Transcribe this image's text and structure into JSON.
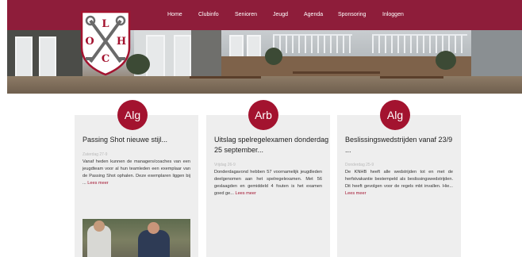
{
  "nav": {
    "items": [
      {
        "label": "Home"
      },
      {
        "label": "Clubinfo"
      },
      {
        "label": "Senioren"
      },
      {
        "label": "Jeugd"
      },
      {
        "label": "Agenda"
      },
      {
        "label": "Sponsoring"
      },
      {
        "label": "Inloggen"
      }
    ]
  },
  "logo": {
    "letters": [
      "L",
      "O",
      "H",
      "C"
    ]
  },
  "posts": [
    {
      "badge": "Alg",
      "title": "Passing Shot nieuwe stijl...",
      "date": "Zaterdag 27-9",
      "excerpt": "Vanaf heden kunnen de managers/coaches van een jeugdteam voor al hun teamleden een exemplaar van de Passing Shot ophalen. Deze exemplaren liggen bij ...",
      "more": "Lees meer"
    },
    {
      "badge": "Arb",
      "title": "Uitslag spelregelexamen donderdag 25 september...",
      "date": "Vrijdag 26-9",
      "excerpt": "Donderdagavond hebben 57 voornamelijk jeugdleden deelgenomen aan het spelregelexamen. Met 56 geslaagden en gemiddeld 4 fouten is het examen goed ge...",
      "more": "Lees meer"
    },
    {
      "badge": "Alg",
      "title": "Beslissingswedstrijden vanaf 23/9 ...",
      "date": "Donderdag 25-9",
      "excerpt": "De KNHB heeft alle wedstrijden tot en met de herfstvakantie bestempeld als beslissingswedstrijden. Dit heeft gevolgen voor de regels mbt invallen. Hie...",
      "more": "Lees meer"
    }
  ],
  "colors": {
    "brand": "#8e1d3a",
    "badge": "#a3132f",
    "card": "#eeeeee"
  }
}
